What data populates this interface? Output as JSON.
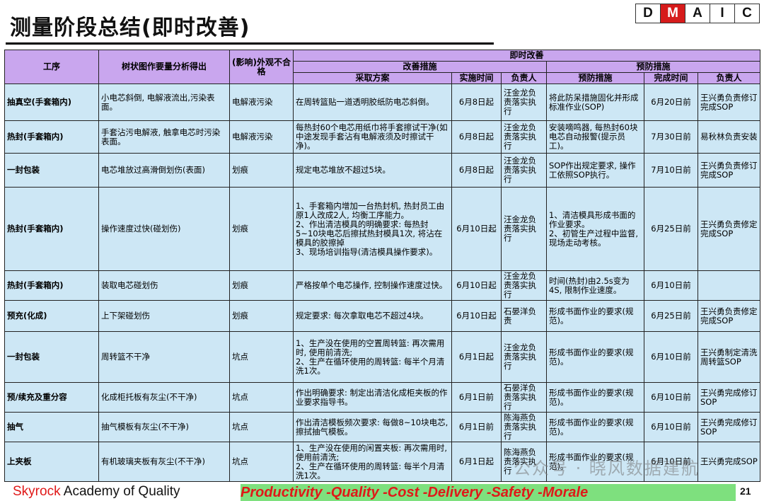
{
  "title": "测量阶段总结(即时改善)",
  "dmaic": [
    "D",
    "M",
    "A",
    "I",
    "C"
  ],
  "dmaic_active_index": 1,
  "dmaic_active_color": "#d61b1b",
  "header": {
    "process": "工序",
    "tree_analysis": "树状图作要量分析得出",
    "impact": "(影响)外观不合格",
    "immediate": "即时改善",
    "improve": "改善措施",
    "prevent": "预防措施",
    "action": "采取方案",
    "impl_time": "实施时间",
    "owner": "负责人",
    "prevent_action": "预防措施",
    "done_time": "完成时间",
    "owner2": "负责人"
  },
  "rows": [
    {
      "process": "抽真空(手套箱内)",
      "cause": "小电芯斜倒, 电解液流出,污染表面。",
      "impact": "电解液污染",
      "action": "在周转篮贴一道透明胶纸防电芯斜倒。",
      "time": "6月8日起",
      "owner": "汪金龙负责落实执行",
      "prevent": "将此防呆措施固化并形成标准作业(SOP)",
      "done": "6月20日前",
      "owner2": "王兴勇负责修订完成SOP"
    },
    {
      "process": "热封(手套箱内)",
      "cause": "手套沾污电解液, 触拿电芯时污染表面。",
      "impact": "电解液污染",
      "action": "每热封60个电芯用纸巾将手套擦试干净(如中途发现手套沾有电解液须及时擦试干净)。",
      "time": "6月8日起",
      "owner": "汪金龙负责落实执行",
      "prevent": "安装嘀鸣器, 每热封60块电芯自动报警(提示员工)。",
      "done": "7月30日前",
      "owner2": "易秋林负责安装"
    },
    {
      "process": "一封包装",
      "cause": "电芯堆放过高滑倒划伤(表面)",
      "impact": "划痕",
      "action": "规定电芯堆放不超过5块。",
      "time": "6月8日起",
      "owner": "汪金龙负责落实执行",
      "prevent": "SOP作出规定要求, 操作工依照SOP执行。",
      "done": "7月10日前",
      "owner2": "王兴勇负责修订完成SOP"
    },
    {
      "process": "热封(手套箱内)",
      "cause": "操作速度过快(碰划伤)",
      "impact": "划痕",
      "action": "1、手套箱内增加一台热封机, 热封员工由原1人改成2人, 均衡工序能力。\n2、作出清洁模具的明确要求: 每热封5~10块电芯后擦拭热封模具1次, 将沾在模具的胶擦掉\n3、现场培训指导(清洁模具操作要求)。",
      "time": "6月10日起",
      "owner": "汪金龙负责落实执行",
      "prevent": "1、清洁模具形成书面的作业要求。\n2、初管生产过程中监督, 现场走动考核。",
      "done": "6月25日前",
      "owner2": "王兴勇负责修定完成SOP"
    },
    {
      "process": "热封(手套箱内)",
      "cause": "装取电芯碰划伤",
      "impact": "划痕",
      "action": "严格按单个电芯操作, 控制操作速度过快。",
      "time": "6月10日起",
      "owner": "汪金龙负责落实执行",
      "prevent": "时间(热封)由2.5s变为4S, 限制作业速度。",
      "done": "6月10日前",
      "owner2": ""
    },
    {
      "process": "预充(化成)",
      "cause": "上下架碰划伤",
      "impact": "划痕",
      "action": "规定要求: 每次拿取电芯不超过4块。",
      "time": "6月10日起",
      "owner": "石晏洋负责",
      "prevent": "形成书面作业的要求(规范)。",
      "done": "6月25日前",
      "owner2": "王兴勇负责修定完成SOP"
    },
    {
      "process": "一封包装",
      "cause": "周转篮不干净",
      "impact": "坑点",
      "action": "1、生产没在使用的空置周转篮: 再次需用时, 使用前清洗;\n2、生产在循环使用的周转篮: 每半个月清洗1次。",
      "time": "6月1日起",
      "owner": "汪金龙负责落实执行",
      "prevent": "形成书面作业的要求(规范)。",
      "done": "6月10日前",
      "owner2": "王兴勇制定清洗周转篮SOP"
    },
    {
      "process": "预/续充及重分容",
      "cause": "化成柜托板有灰尘(不干净)",
      "impact": "坑点",
      "action": "作出明确要求: 制定出清洁化成柜夹板的作业要求指导书。",
      "time": "6月1日前",
      "owner": "石晏洋负责落实执行",
      "prevent": "形成书面作业的要求(规范)。",
      "done": "6月10日前",
      "owner2": "王兴勇完成修订SOP"
    },
    {
      "process": "抽气",
      "cause": "抽气模板有灰尘(不干净)",
      "impact": "坑点",
      "action": "作出清洁模板频次要求: 每做8~10块电芯, 擦拭抽气模板。",
      "time": "6月1日前",
      "owner": "陈海燕负责落实执行",
      "prevent": "形成书面作业的要求(规范)。",
      "done": "6月10日前",
      "owner2": "王兴勇完成修订SOP"
    },
    {
      "process": "上夹板",
      "cause": "有机玻璃夹板有灰尘(不干净)",
      "impact": "坑点",
      "action": "1、生产没在使用的闲置夹板: 再次需用时, 使用前清洗;\n2、生产在循环使用的周转篮: 每半个月清洗1次。",
      "time": "6月1日起",
      "owner": "陈海燕负责落实执行",
      "prevent": "形成书面作业的要求(规范)。",
      "done": "6月10日前",
      "owner2": "王兴勇完成SOP"
    }
  ],
  "footer": {
    "brand_red": "Skyrock",
    "brand_rest": " Academy of Quality",
    "slogan": "Productivity -Quality -Cost -Delivery -Safety -Morale",
    "page": "21"
  },
  "watermark": "公众号 · 晓风数据建航",
  "colors": {
    "header_bg": "#c9a6ee",
    "cell_bg": "#cde7f5",
    "slogan_bg": "#7ee07e",
    "slogan_text": "#e01818"
  }
}
